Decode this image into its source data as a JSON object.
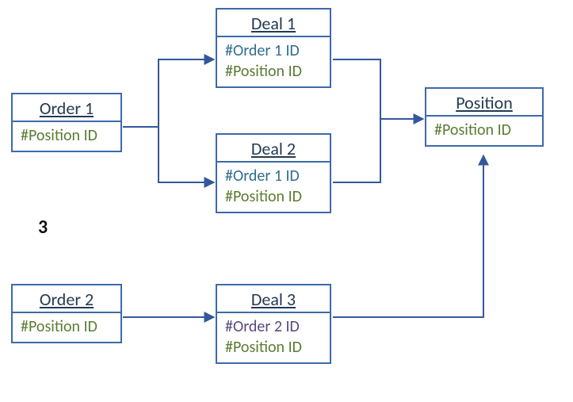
{
  "nodes": {
    "order1": {
      "title": "Order 1",
      "fields": [
        "#Position ID"
      ]
    },
    "order2": {
      "title": "Order 2",
      "fields": [
        "#Position ID"
      ]
    },
    "deal1": {
      "title": "Deal 1",
      "fields": [
        "#Order 1 ID",
        "#Position ID"
      ]
    },
    "deal2": {
      "title": "Deal 2",
      "fields": [
        "#Order 1 ID",
        "#Position ID"
      ]
    },
    "deal3": {
      "title": "Deal 3",
      "fields": [
        "#Order 2 ID",
        "#Position ID"
      ]
    },
    "position": {
      "title": "Position",
      "fields": [
        "#Position ID"
      ]
    }
  },
  "side_label": "3",
  "chart_data": {
    "type": "diagram",
    "title": "",
    "nodes": [
      {
        "id": "order1",
        "label": "Order 1",
        "fields": [
          "#Position ID"
        ]
      },
      {
        "id": "order2",
        "label": "Order 2",
        "fields": [
          "#Position ID"
        ]
      },
      {
        "id": "deal1",
        "label": "Deal 1",
        "fields": [
          "#Order 1 ID",
          "#Position ID"
        ]
      },
      {
        "id": "deal2",
        "label": "Deal 2",
        "fields": [
          "#Order 1 ID",
          "#Position ID"
        ]
      },
      {
        "id": "deal3",
        "label": "Deal 3",
        "fields": [
          "#Order 2 ID",
          "#Position ID"
        ]
      },
      {
        "id": "position",
        "label": "Position",
        "fields": [
          "#Position ID"
        ]
      }
    ],
    "edges": [
      {
        "from": "order1",
        "to": "deal1"
      },
      {
        "from": "order1",
        "to": "deal2"
      },
      {
        "from": "deal1",
        "to": "position"
      },
      {
        "from": "deal2",
        "to": "position"
      },
      {
        "from": "order2",
        "to": "deal3"
      },
      {
        "from": "deal3",
        "to": "position"
      }
    ]
  }
}
